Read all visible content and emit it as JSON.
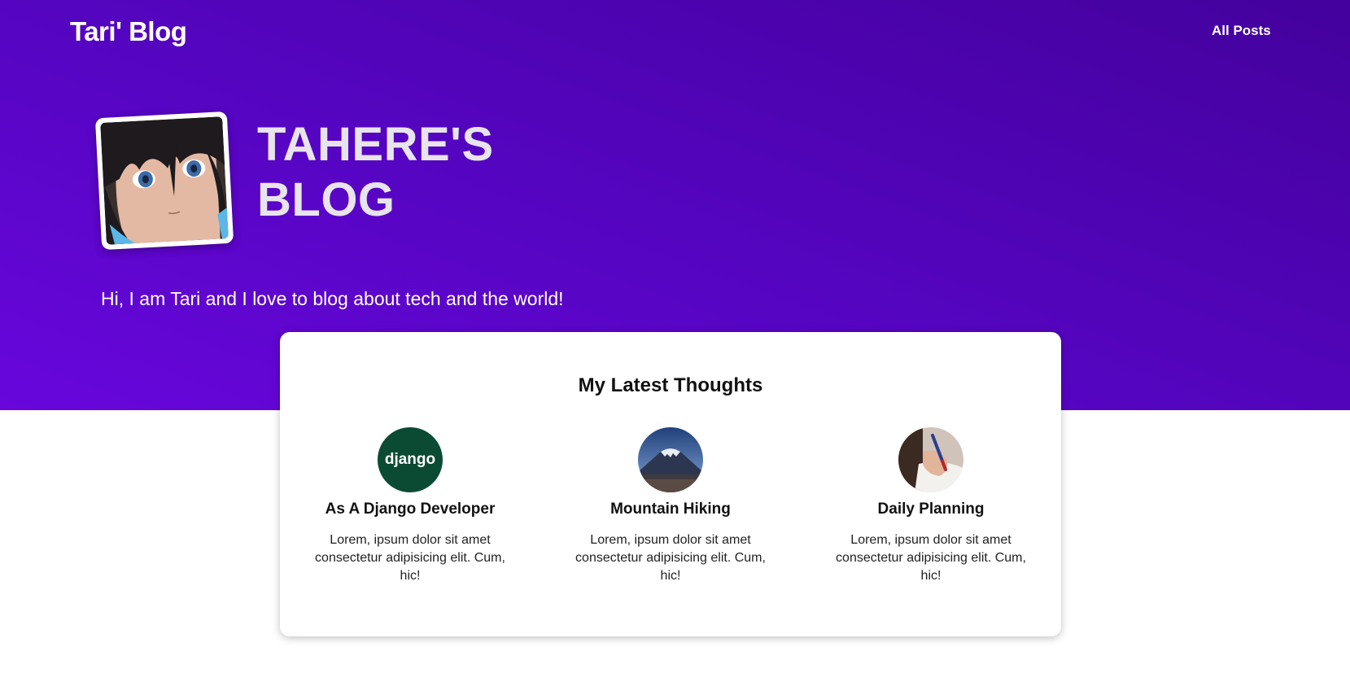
{
  "header": {
    "site_title": "Tari' Blog",
    "nav_all_posts": "All Posts"
  },
  "hero": {
    "blog_title_line1": "TAHERE'S",
    "blog_title_line2": "BLOG",
    "tagline": "Hi, I am Tari and I love to blog about tech and the world!"
  },
  "latest": {
    "heading": "My Latest Thoughts",
    "posts": [
      {
        "title": "As A Django Developer",
        "excerpt": "Lorem, ipsum dolor sit amet consectetur adipisicing elit. Cum, hic!",
        "thumb_text": "django",
        "thumb_icon": "django-logo-icon"
      },
      {
        "title": "Mountain Hiking",
        "excerpt": "Lorem, ipsum dolor sit amet consectetur adipisicing elit. Cum, hic!",
        "thumb_icon": "mountain-photo-icon"
      },
      {
        "title": "Daily Planning",
        "excerpt": "Lorem, ipsum dolor sit amet consectetur adipisicing elit. Cum, hic!",
        "thumb_icon": "writing-hand-photo-icon"
      }
    ]
  },
  "colors": {
    "hero_gradient_start": "#6806dc",
    "hero_gradient_end": "#44019d",
    "django_green": "#0c4b33"
  }
}
